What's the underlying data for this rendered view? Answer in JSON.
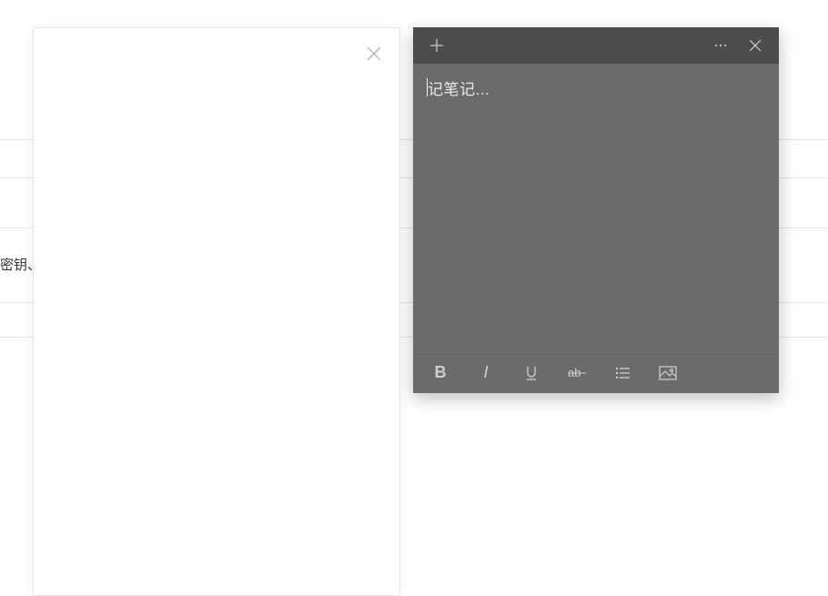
{
  "background": {
    "partial_text": "密钥、"
  },
  "leftPanel": {
    "close_label": "Close"
  },
  "note": {
    "titlebar": {
      "new_note_label": "New note",
      "menu_label": "Menu",
      "close_label": "Close"
    },
    "body": {
      "placeholder": "记笔记..."
    },
    "toolbar": {
      "bold_glyph": "B",
      "italic_glyph": "I",
      "bold_label": "Bold",
      "italic_label": "Italic",
      "underline_label": "Underline",
      "strike_label": "Strikethrough",
      "list_label": "Toggle bullets",
      "image_label": "Add image"
    }
  }
}
